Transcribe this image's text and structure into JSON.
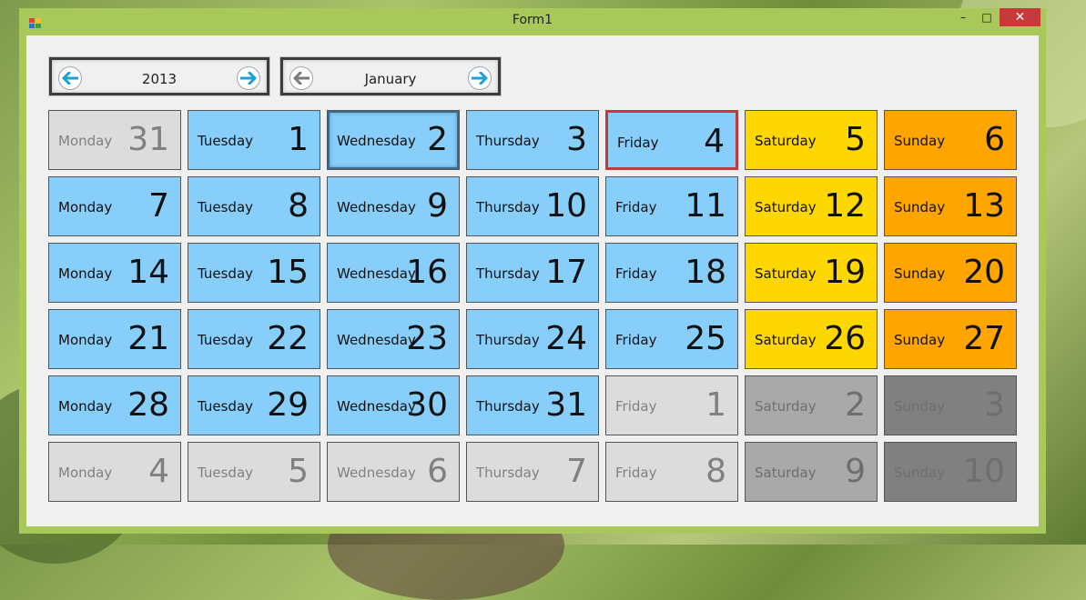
{
  "window": {
    "title": "Form1",
    "controls": {
      "minimize": "–",
      "maximize": "□",
      "close": "✕"
    }
  },
  "navigator": {
    "year": "2013",
    "month": "January",
    "prev_icon": "arrow-left-icon",
    "next_icon": "arrow-right-icon"
  },
  "colors": {
    "weekday": "#87cefa",
    "saturday": "#ffd700",
    "sunday": "#ffa500",
    "other_month_weekday": "#dcdcdc",
    "other_month_saturday": "#a9a9a9",
    "other_month_sunday": "#808080",
    "today_border": "#c0393b",
    "titlebar": "#a8c95a",
    "close_button": "#c7393a"
  },
  "calendar": {
    "focused_day": "2",
    "today_day": "4",
    "weeks": [
      [
        {
          "day": "Monday",
          "num": "31",
          "type": "gray"
        },
        {
          "day": "Tuesday",
          "num": "1",
          "type": "blue"
        },
        {
          "day": "Wednesday",
          "num": "2",
          "type": "blue",
          "focused": true
        },
        {
          "day": "Thursday",
          "num": "3",
          "type": "blue"
        },
        {
          "day": "Friday",
          "num": "4",
          "type": "blue",
          "today": true
        },
        {
          "day": "Saturday",
          "num": "5",
          "type": "yellow"
        },
        {
          "day": "Sunday",
          "num": "6",
          "type": "orange"
        }
      ],
      [
        {
          "day": "Monday",
          "num": "7",
          "type": "blue"
        },
        {
          "day": "Tuesday",
          "num": "8",
          "type": "blue"
        },
        {
          "day": "Wednesday",
          "num": "9",
          "type": "blue"
        },
        {
          "day": "Thursday",
          "num": "10",
          "type": "blue"
        },
        {
          "day": "Friday",
          "num": "11",
          "type": "blue"
        },
        {
          "day": "Saturday",
          "num": "12",
          "type": "yellow"
        },
        {
          "day": "Sunday",
          "num": "13",
          "type": "orange"
        }
      ],
      [
        {
          "day": "Monday",
          "num": "14",
          "type": "blue"
        },
        {
          "day": "Tuesday",
          "num": "15",
          "type": "blue"
        },
        {
          "day": "Wednesday",
          "num": "16",
          "type": "blue"
        },
        {
          "day": "Thursday",
          "num": "17",
          "type": "blue"
        },
        {
          "day": "Friday",
          "num": "18",
          "type": "blue"
        },
        {
          "day": "Saturday",
          "num": "19",
          "type": "yellow"
        },
        {
          "day": "Sunday",
          "num": "20",
          "type": "orange"
        }
      ],
      [
        {
          "day": "Monday",
          "num": "21",
          "type": "blue"
        },
        {
          "day": "Tuesday",
          "num": "22",
          "type": "blue"
        },
        {
          "day": "Wednesday",
          "num": "23",
          "type": "blue"
        },
        {
          "day": "Thursday",
          "num": "24",
          "type": "blue"
        },
        {
          "day": "Friday",
          "num": "25",
          "type": "blue"
        },
        {
          "day": "Saturday",
          "num": "26",
          "type": "yellow"
        },
        {
          "day": "Sunday",
          "num": "27",
          "type": "orange"
        }
      ],
      [
        {
          "day": "Monday",
          "num": "28",
          "type": "blue"
        },
        {
          "day": "Tuesday",
          "num": "29",
          "type": "blue"
        },
        {
          "day": "Wednesday",
          "num": "30",
          "type": "blue"
        },
        {
          "day": "Thursday",
          "num": "31",
          "type": "blue"
        },
        {
          "day": "Friday",
          "num": "1",
          "type": "gray"
        },
        {
          "day": "Saturday",
          "num": "2",
          "type": "dgray"
        },
        {
          "day": "Sunday",
          "num": "3",
          "type": "ddgray"
        }
      ],
      [
        {
          "day": "Monday",
          "num": "4",
          "type": "gray"
        },
        {
          "day": "Tuesday",
          "num": "5",
          "type": "gray"
        },
        {
          "day": "Wednesday",
          "num": "6",
          "type": "gray"
        },
        {
          "day": "Thursday",
          "num": "7",
          "type": "gray"
        },
        {
          "day": "Friday",
          "num": "8",
          "type": "gray"
        },
        {
          "day": "Saturday",
          "num": "9",
          "type": "dgray"
        },
        {
          "day": "Sunday",
          "num": "10",
          "type": "ddgray"
        }
      ]
    ]
  }
}
